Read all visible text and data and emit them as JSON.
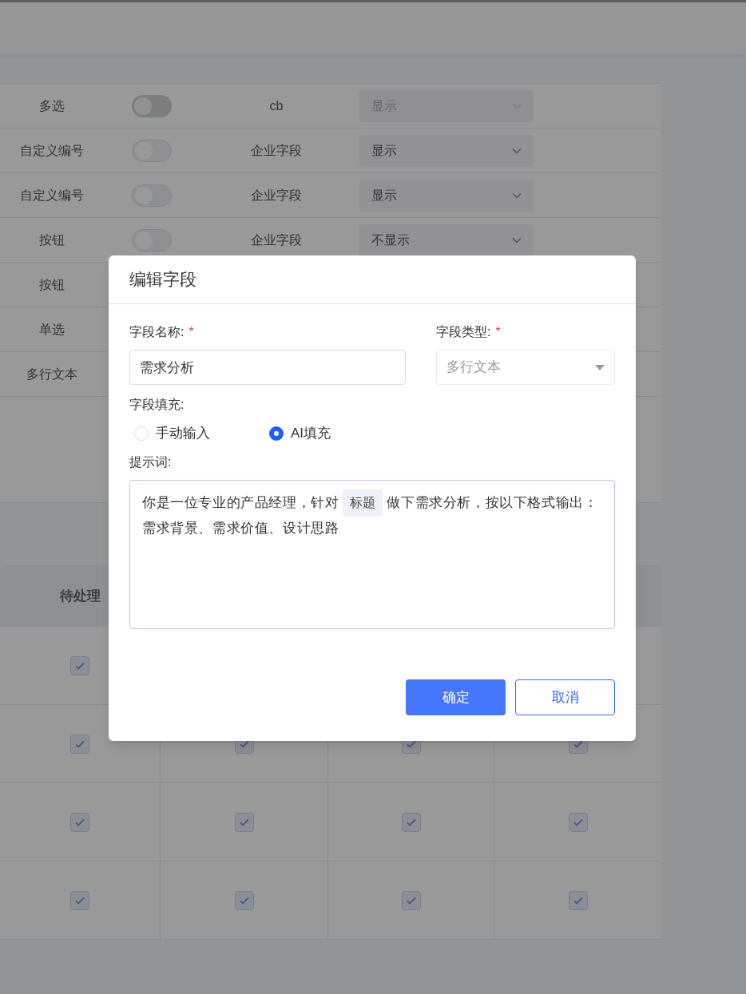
{
  "field_table": {
    "rows": [
      {
        "name": "多选",
        "toggle": {
          "disabled": true
        },
        "type": "cb",
        "display": {
          "value": "显示",
          "disabled": true
        }
      },
      {
        "name": "自定义编号",
        "toggle": {
          "disabled": false
        },
        "type": "企业字段",
        "display": {
          "value": "显示",
          "disabled": false
        }
      },
      {
        "name": "自定义编号",
        "toggle": {
          "disabled": false
        },
        "type": "企业字段",
        "display": {
          "value": "显示",
          "disabled": false
        }
      },
      {
        "name": "按钮",
        "toggle": {
          "disabled": false
        },
        "type": "企业字段",
        "display": {
          "value": "不显示",
          "disabled": false
        }
      },
      {
        "name": "按钮"
      },
      {
        "name": "单选"
      },
      {
        "name": "多行文本"
      }
    ]
  },
  "permission_table": {
    "columns": [
      "待处理"
    ],
    "rows": [
      {
        "cells": [
          {
            "checked": true
          }
        ]
      },
      {
        "cells": [
          {
            "checked": true
          },
          {
            "checked": true
          },
          {
            "checked": true
          },
          {
            "checked": true
          }
        ]
      },
      {
        "cells": [
          {
            "checked": true
          },
          {
            "checked": true
          },
          {
            "checked": true
          },
          {
            "checked": true
          }
        ]
      },
      {
        "cells": [
          {
            "checked": true
          },
          {
            "checked": true
          },
          {
            "checked": true
          },
          {
            "checked": true
          }
        ]
      }
    ]
  },
  "dialog": {
    "title": "编辑字段",
    "name_field": {
      "label": "字段名称:",
      "required_mark": "*",
      "value": "需求分析"
    },
    "type_field": {
      "label": "字段类型:",
      "required_mark": "*",
      "value": "多行文本",
      "disabled": true
    },
    "fill": {
      "label": "字段填充:",
      "options": [
        {
          "label": "手动输入",
          "selected": false
        },
        {
          "label": "AI填充",
          "selected": true
        }
      ]
    },
    "prompt": {
      "label": "提示词:",
      "lines": [
        [
          {
            "kind": "text",
            "text": "你是一位专业的产品经理，针对"
          },
          {
            "kind": "tag",
            "text": "标题"
          },
          {
            "kind": "text",
            "text": "做下需求分析，按以下格式输出："
          }
        ],
        [
          {
            "kind": "text",
            "text": "需求背景、需求价值、设计思路"
          }
        ]
      ]
    },
    "buttons": [
      {
        "label": "确定",
        "kind": "primary"
      },
      {
        "label": "取消",
        "kind": "secondary"
      }
    ]
  }
}
